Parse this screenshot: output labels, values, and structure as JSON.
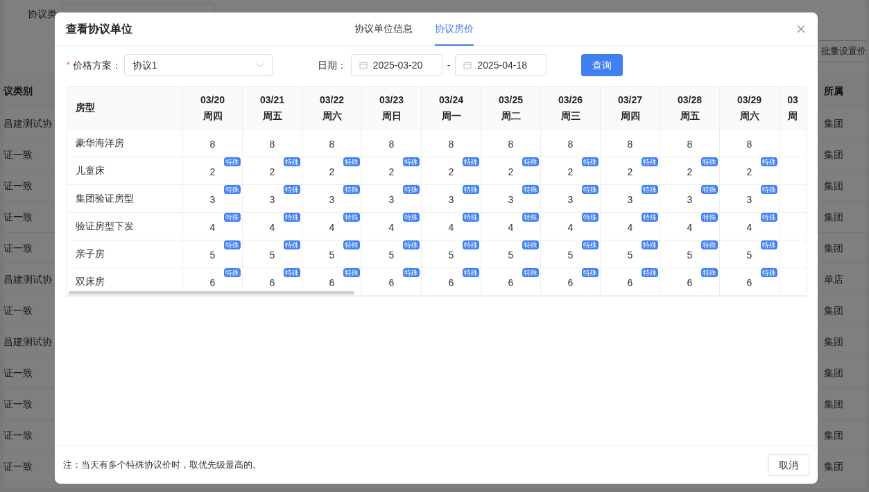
{
  "background_page": {
    "filter_label": "协议类",
    "batch_button": "批量设置价",
    "left_header": "议类别",
    "right_header": "所属",
    "left_cells": [
      "昌建测试协",
      "证一致",
      "证一致",
      "证一致",
      "证一致",
      "昌建测试协",
      "证一致",
      "昌建测试协",
      "证一致",
      "证一致",
      "证一致",
      "证一致"
    ],
    "right_cells": [
      "集团",
      "集团",
      "集团",
      "集团",
      "集团",
      "单店",
      "集团",
      "集团",
      "集团",
      "集团",
      "集团",
      "集团"
    ]
  },
  "dialog": {
    "title": "查看协议单位",
    "tabs": [
      {
        "label": "协议单位信息",
        "selected": false
      },
      {
        "label": "协议房价",
        "selected": true
      }
    ],
    "price_plan": {
      "required_mark": "*",
      "label": "价格方案：",
      "value": "协议1"
    },
    "date_range": {
      "label": "日期：",
      "start": "2025-03-20",
      "separator": "-",
      "end": "2025-04-18"
    },
    "query_button": "查询",
    "table": {
      "room_type_header": "房型",
      "columns": [
        {
          "date": "03/20",
          "weekday": "周四"
        },
        {
          "date": "03/21",
          "weekday": "周五"
        },
        {
          "date": "03/22",
          "weekday": "周六"
        },
        {
          "date": "03/23",
          "weekday": "周日"
        },
        {
          "date": "03/24",
          "weekday": "周一"
        },
        {
          "date": "03/25",
          "weekday": "周二"
        },
        {
          "date": "03/26",
          "weekday": "周三"
        },
        {
          "date": "03/27",
          "weekday": "周四"
        },
        {
          "date": "03/28",
          "weekday": "周五"
        },
        {
          "date": "03/29",
          "weekday": "周六"
        },
        {
          "date": "03",
          "weekday": "周"
        }
      ],
      "rows": [
        {
          "room_type": "豪华海洋房",
          "cells": [
            {
              "price": "8"
            },
            {
              "price": "8"
            },
            {
              "price": "8"
            },
            {
              "price": "8"
            },
            {
              "price": "8"
            },
            {
              "price": "8"
            },
            {
              "price": "8"
            },
            {
              "price": "8"
            },
            {
              "price": "8"
            },
            {
              "price": "8"
            }
          ]
        },
        {
          "room_type": "儿童床",
          "cells": [
            {
              "price": "2",
              "badge": "特殊"
            },
            {
              "price": "2",
              "badge": "特殊"
            },
            {
              "price": "2",
              "badge": "特殊"
            },
            {
              "price": "2",
              "badge": "特殊"
            },
            {
              "price": "2",
              "badge": "特殊"
            },
            {
              "price": "2",
              "badge": "特殊"
            },
            {
              "price": "2",
              "badge": "特殊"
            },
            {
              "price": "2",
              "badge": "特殊"
            },
            {
              "price": "2",
              "badge": "特殊"
            },
            {
              "price": "2",
              "badge": "特殊"
            }
          ]
        },
        {
          "room_type": "集团验证房型",
          "cells": [
            {
              "price": "3",
              "badge": "特殊"
            },
            {
              "price": "3",
              "badge": "特殊"
            },
            {
              "price": "3",
              "badge": "特殊"
            },
            {
              "price": "3",
              "badge": "特殊"
            },
            {
              "price": "3",
              "badge": "特殊"
            },
            {
              "price": "3",
              "badge": "特殊"
            },
            {
              "price": "3",
              "badge": "特殊"
            },
            {
              "price": "3",
              "badge": "特殊"
            },
            {
              "price": "3",
              "badge": "特殊"
            },
            {
              "price": "3",
              "badge": "特殊"
            }
          ]
        },
        {
          "room_type": "验证房型下发",
          "cells": [
            {
              "price": "4",
              "badge": "特殊"
            },
            {
              "price": "4",
              "badge": "特殊"
            },
            {
              "price": "4",
              "badge": "特殊"
            },
            {
              "price": "4",
              "badge": "特殊"
            },
            {
              "price": "4",
              "badge": "特殊"
            },
            {
              "price": "4",
              "badge": "特殊"
            },
            {
              "price": "4",
              "badge": "特殊"
            },
            {
              "price": "4",
              "badge": "特殊"
            },
            {
              "price": "4",
              "badge": "特殊"
            },
            {
              "price": "4",
              "badge": "特殊"
            }
          ]
        },
        {
          "room_type": "亲子房",
          "cells": [
            {
              "price": "5",
              "badge": "特殊"
            },
            {
              "price": "5",
              "badge": "特殊"
            },
            {
              "price": "5",
              "badge": "特殊"
            },
            {
              "price": "5",
              "badge": "特殊"
            },
            {
              "price": "5",
              "badge": "特殊"
            },
            {
              "price": "5",
              "badge": "特殊"
            },
            {
              "price": "5",
              "badge": "特殊"
            },
            {
              "price": "5",
              "badge": "特殊"
            },
            {
              "price": "5",
              "badge": "特殊"
            },
            {
              "price": "5",
              "badge": "特殊"
            }
          ]
        },
        {
          "room_type": "双床房",
          "cells": [
            {
              "price": "6",
              "badge": "特殊"
            },
            {
              "price": "6",
              "badge": "特殊"
            },
            {
              "price": "6",
              "badge": "特殊"
            },
            {
              "price": "6",
              "badge": "特殊"
            },
            {
              "price": "6",
              "badge": "特殊"
            },
            {
              "price": "6",
              "badge": "特殊"
            },
            {
              "price": "6",
              "badge": "特殊"
            },
            {
              "price": "6",
              "badge": "特殊"
            },
            {
              "price": "6",
              "badge": "特殊"
            },
            {
              "price": "6",
              "badge": "特殊"
            }
          ]
        }
      ]
    },
    "note": "注：当天有多个特殊协议价时，取优先级最高的。",
    "cancel_button": "取消"
  }
}
